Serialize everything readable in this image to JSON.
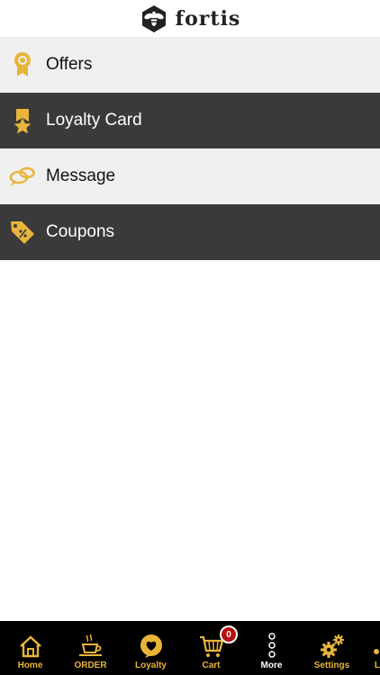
{
  "brand": {
    "name": "fortis",
    "logo_icon": "bee-hexagon-icon"
  },
  "colors": {
    "accent": "#e8b53a",
    "dark_row": "#3a3a3a",
    "light_row": "#f0f0f0",
    "tabbar": "#000000",
    "badge": "#b31010"
  },
  "menu": {
    "items": [
      {
        "label": "Offers",
        "icon": "award-ribbon-icon"
      },
      {
        "label": "Loyalty Card",
        "icon": "star-ribbon-icon"
      },
      {
        "label": "Message",
        "icon": "chat-bubbles-icon"
      },
      {
        "label": "Coupons",
        "icon": "percent-tag-icon"
      }
    ]
  },
  "tabbar": {
    "tabs": [
      {
        "label": "Home",
        "icon": "house-icon"
      },
      {
        "label": "ORDER",
        "icon": "coffee-cup-icon"
      },
      {
        "label": "Loyalty",
        "icon": "heart-bubble-icon"
      },
      {
        "label": "Cart",
        "icon": "cart-icon",
        "badge": "0"
      },
      {
        "label": "More",
        "icon": "more-dots-icon"
      },
      {
        "label": "Settings",
        "icon": "gears-icon"
      },
      {
        "label": "L",
        "icon": "partial-tab-icon"
      }
    ]
  }
}
